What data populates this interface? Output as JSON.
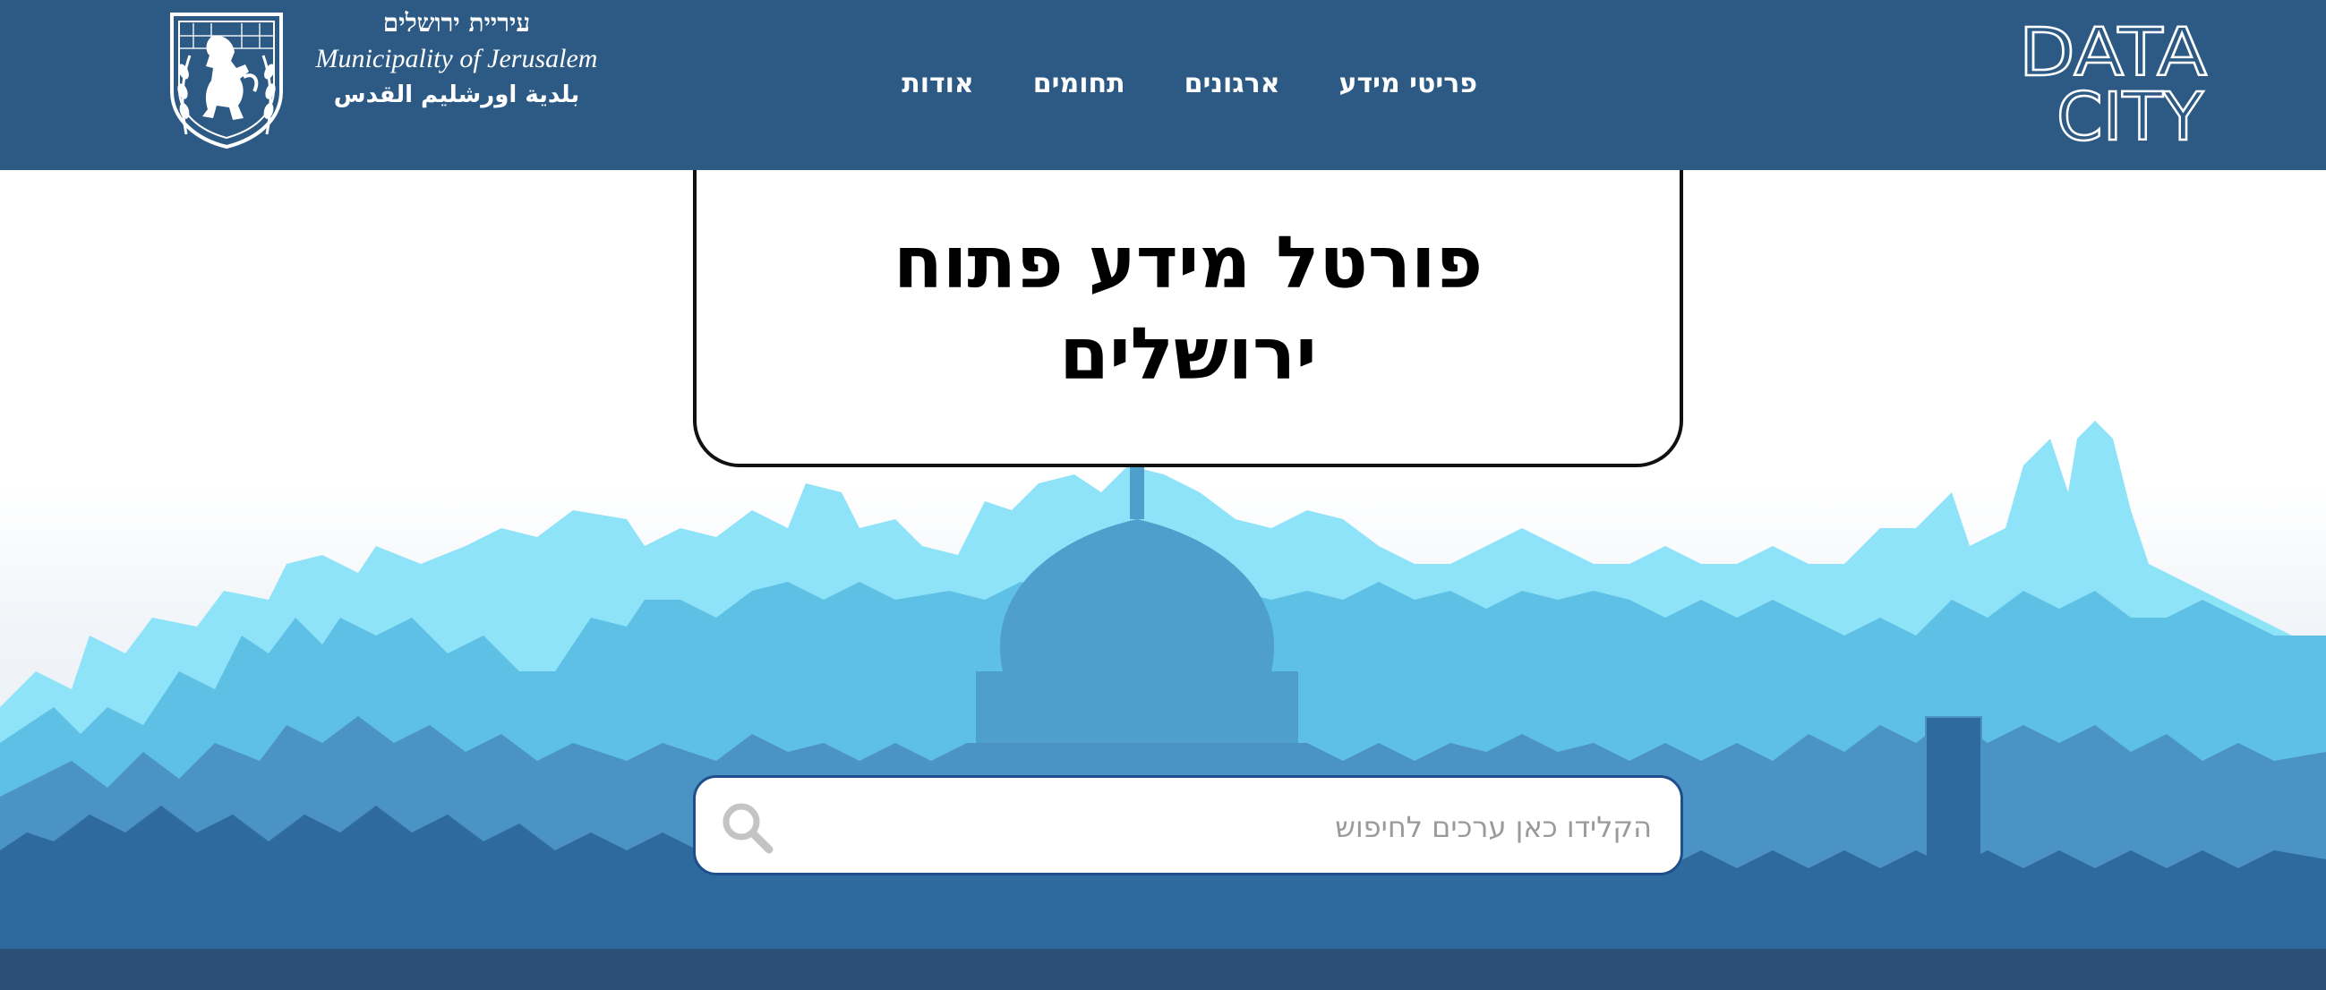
{
  "header": {
    "logo_text": {
      "line1": "DATA",
      "line2": "CITY"
    },
    "nav": [
      {
        "label": "פריטי מידע"
      },
      {
        "label": "ארגונים"
      },
      {
        "label": "תחומים"
      },
      {
        "label": "אודות"
      }
    ],
    "municipality": {
      "hebrew": "עיריית ירושלים",
      "english": "Municipality of Jerusalem",
      "arabic": "بلدية اورشليم القدس"
    }
  },
  "hero": {
    "title": "פורטל מידע פתוח ירושלים"
  },
  "search": {
    "placeholder": "הקלידו כאן ערכים לחיפוש",
    "icon": "search-icon"
  },
  "colors": {
    "header_bg": "#2c5a84",
    "footer_bg": "#2b4f76",
    "search_border": "#1f4e8c",
    "skyline_light": "#8ee3f8",
    "skyline_mid": "#5cb6e0",
    "skyline_dark": "#2f6a9e"
  }
}
